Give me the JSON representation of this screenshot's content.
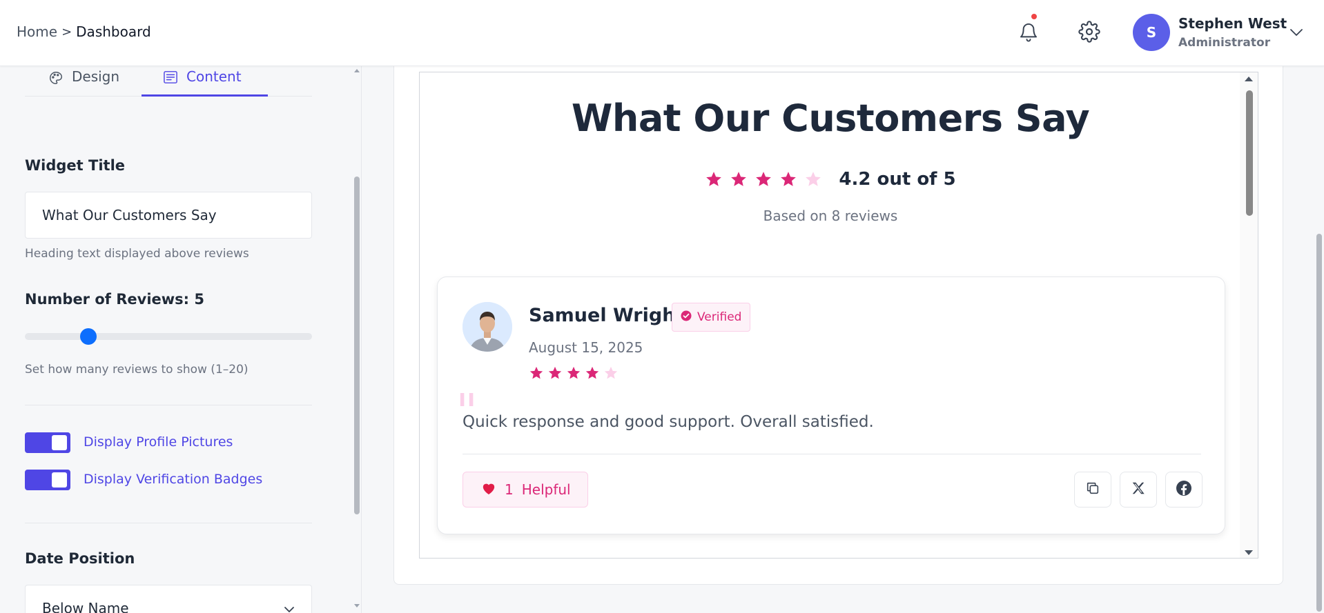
{
  "header": {
    "breadcrumb": {
      "home": "Home",
      "separator": ">",
      "current": "Dashboard"
    },
    "icons": {
      "bell": "bell-icon",
      "settings": "gear-icon",
      "chevron": "chevron-down-icon"
    },
    "user": {
      "initial": "S",
      "name": "Stephen West",
      "role": "Administrator"
    }
  },
  "sidebar": {
    "tabs": [
      {
        "label": "Design",
        "icon": "palette-icon",
        "active": false
      },
      {
        "label": "Content",
        "icon": "content-list-icon",
        "active": true
      }
    ],
    "widget_title": {
      "label": "Widget Title",
      "value": "What Our Customers Say",
      "help": "Heading text displayed above reviews"
    },
    "review_count": {
      "label": "Number of Reviews: ",
      "value": "5",
      "min": 1,
      "max": 20,
      "help": "Set how many reviews to show (1–20)"
    },
    "toggles": [
      {
        "label": "Display Profile Pictures",
        "on": true
      },
      {
        "label": "Display Verification Badges",
        "on": true
      }
    ],
    "date_position": {
      "label": "Date Position",
      "value": "Below Name"
    }
  },
  "preview": {
    "title": "What Our Customers Say",
    "rating_text": "4.2 out of 5",
    "rating_stars": 4,
    "based_on": "Based on 8 reviews",
    "review": {
      "name": "Samuel Wright",
      "badge": "Verified",
      "date": "August 15, 2025",
      "stars": 4,
      "text": "Quick response and good support. Overall satisfied.",
      "helpful_count": "1",
      "helpful_label": "Helpful",
      "share_icons": [
        "copy-icon",
        "x-twitter-icon",
        "facebook-icon"
      ]
    }
  },
  "colors": {
    "accent": "#4f46e5",
    "star": "#db2777",
    "star_empty": "#fbcfe8",
    "avatar": "#5b5fe8"
  }
}
